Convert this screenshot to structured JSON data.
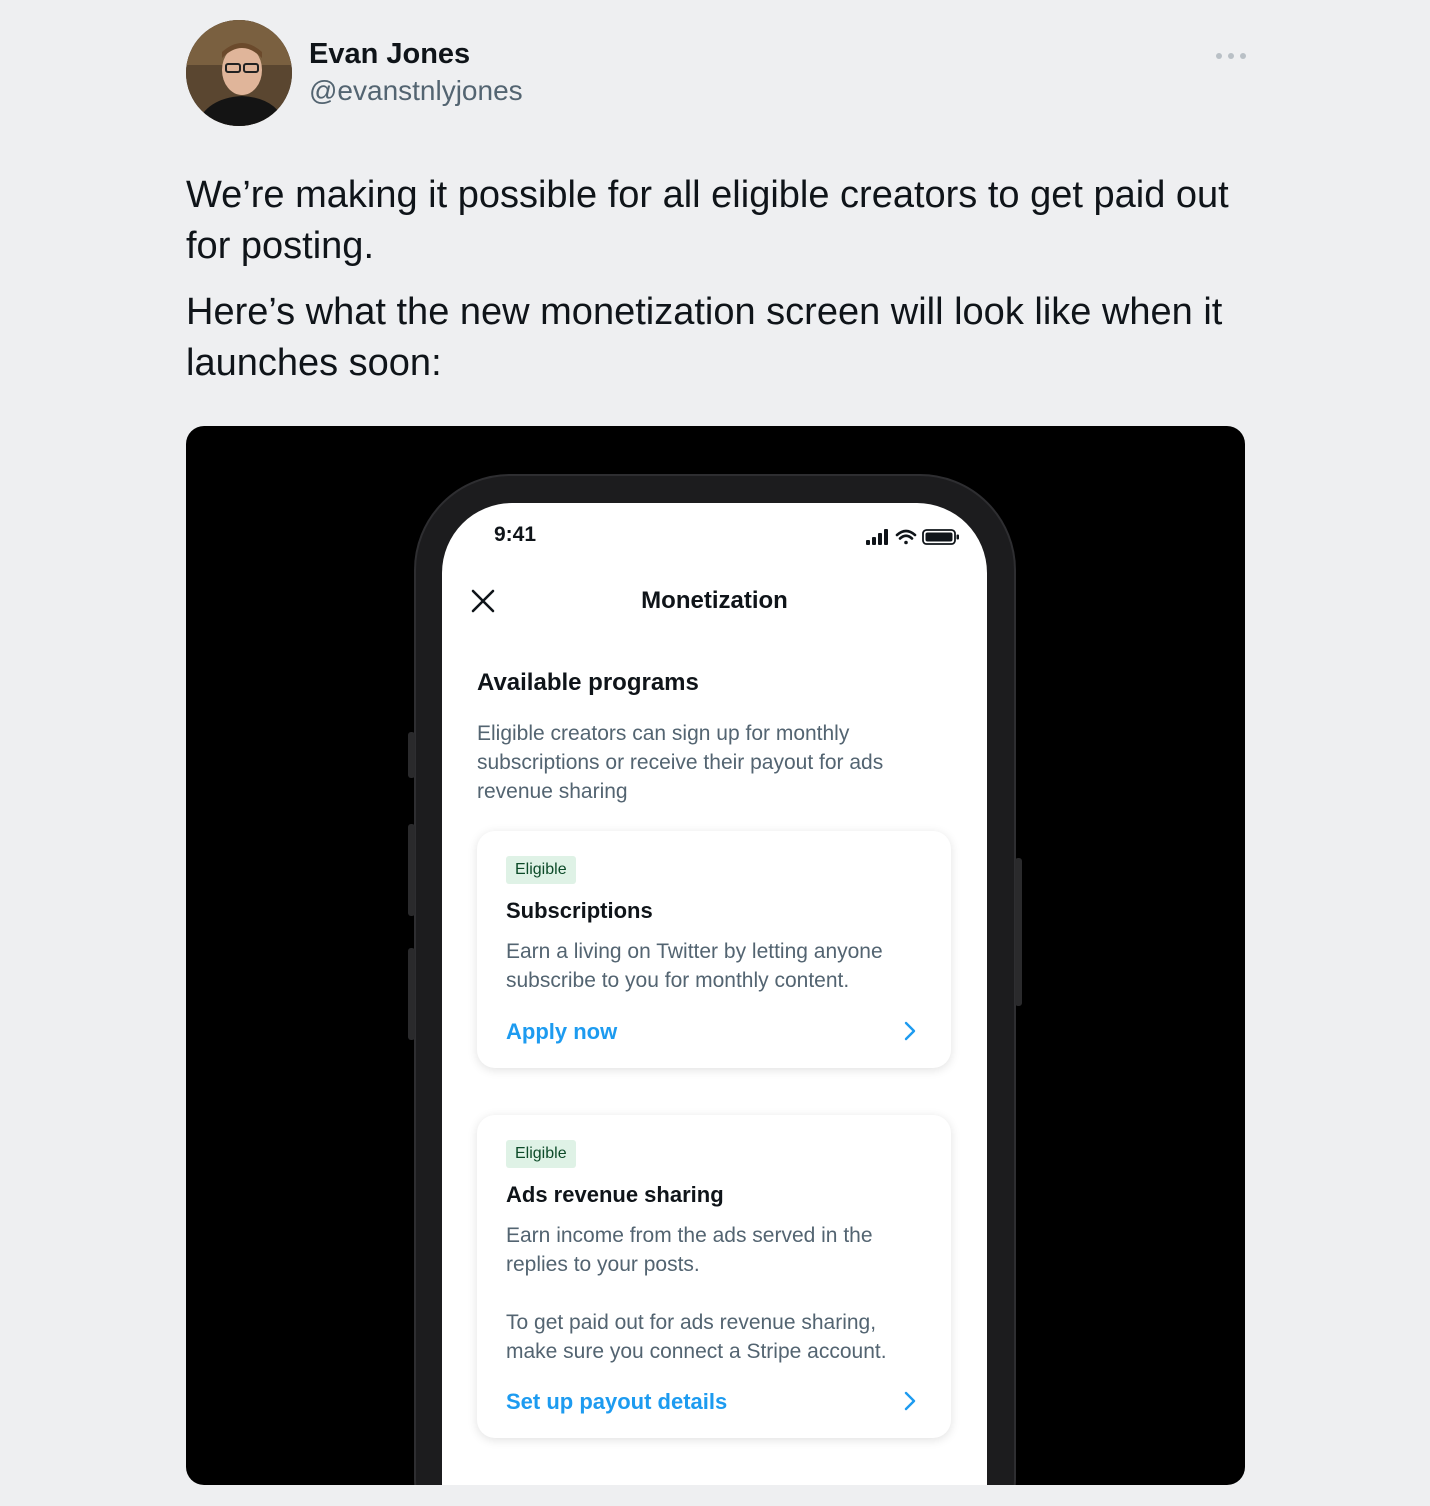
{
  "author": {
    "name": "Evan Jones",
    "handle": "@evanstnlyjones"
  },
  "tweet": {
    "paragraphs": [
      "We’re making it possible for all eligible creators to get paid out for posting.",
      "Here’s what the new monetization screen will look like when it launches soon:"
    ]
  },
  "icons": {
    "more": "more-horizontal-icon",
    "close": "close-icon",
    "signal": "cellular-signal-icon",
    "wifi": "wifi-icon",
    "battery": "battery-icon",
    "chevron": "chevron-right-icon"
  },
  "phone": {
    "status_time": "9:41",
    "nav_title": "Monetization",
    "section_title": "Available programs",
    "section_description": "Eligible creators can sign up for monthly subscriptions or receive their payout for ads revenue sharing",
    "cards": [
      {
        "badge": "Eligible",
        "title": "Subscriptions",
        "description": "Earn a living on Twitter by letting anyone subscribe to you for monthly content.",
        "link": "Apply now"
      },
      {
        "badge": "Eligible",
        "title": "Ads revenue sharing",
        "description": "Earn income from the ads served in the replies to your posts.",
        "description_2": "To get paid out for ads revenue sharing, make sure you connect a Stripe account.",
        "link": "Set up payout details"
      }
    ]
  },
  "colors": {
    "background": "#eeeff1",
    "link_blue": "#1d9bf0",
    "secondary_text": "#536471",
    "badge_bg": "#dff2e6",
    "badge_text": "#0c4a28"
  }
}
